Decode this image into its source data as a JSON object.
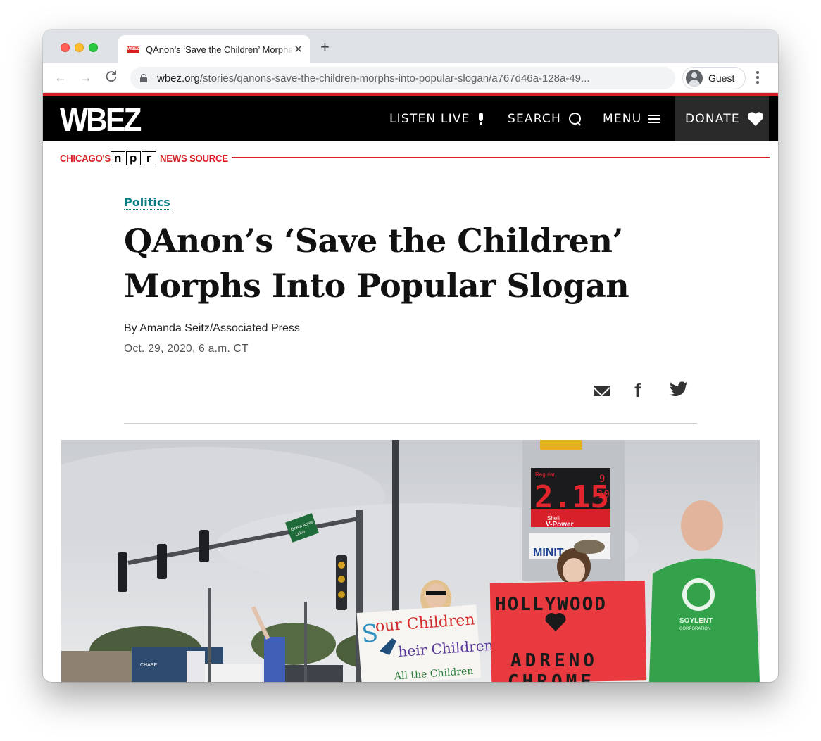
{
  "browser": {
    "tab_title": "QAnon’s ‘Save the Children’ Morphs Into Popular Slogan",
    "tab_close": "✕",
    "new_tab": "+",
    "favicon_text": "WBEZ",
    "url_domain": "wbez.org",
    "url_path": "/stories/qanons-save-the-children-morphs-into-popular-slogan/a767d46a-128a-49...",
    "profile_label": "Guest",
    "back": "←",
    "forward": "→",
    "reload": "C"
  },
  "site": {
    "logo": "WBEZ",
    "nav": {
      "listen": "LISTEN LIVE",
      "search": "SEARCH",
      "menu": "MENU",
      "donate": "DONATE"
    },
    "tagline_before": "CHICAGO'S",
    "npr_letters": [
      "n",
      "p",
      "r"
    ],
    "tagline_after": "NEWS SOURCE",
    "colors": {
      "brand_red": "#d81f26",
      "category_teal": "#057c81"
    }
  },
  "article": {
    "category": "Politics",
    "headline": "QAnon’s ‘Save the Children’ Morphs Into Popular Slogan",
    "byline": "By Amanda Seitz/Associated Press",
    "date": "Oct. 29, 2020, 6 a.m. CT",
    "share_icons": [
      "email-icon",
      "facebook-icon",
      "twitter-icon"
    ]
  },
  "photo": {
    "street_sign": [
      "Green Acres",
      "Drive"
    ],
    "price_label": "Regular",
    "price": "2.15",
    "price_fraction_top": "9",
    "price_fraction_bottom": "10",
    "fuel_brand": "Shell",
    "fuel_name": "V-Power",
    "store_sign": "MINIT",
    "sign_left": [
      "S",
      "our Children",
      "heir Children",
      "All the Children"
    ],
    "sign_right": [
      "HOLLYWOOD",
      "ADRENO",
      "CHROME"
    ],
    "shirt_text": "SOYLENT",
    "shirt_subtext": "CORPORATION",
    "bank_sign": "CHASE"
  }
}
